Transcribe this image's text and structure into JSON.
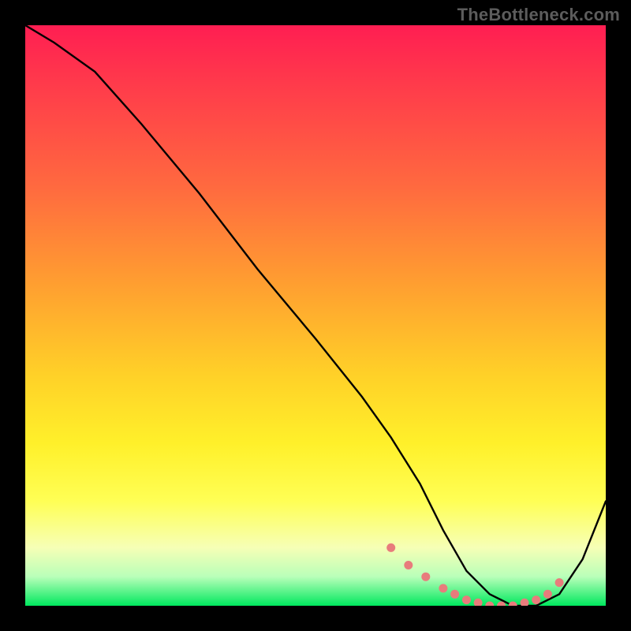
{
  "watermark": "TheBottleneck.com",
  "chart_data": {
    "type": "line",
    "title": "",
    "xlabel": "",
    "ylabel": "",
    "xlim": [
      0,
      100
    ],
    "ylim": [
      0,
      100
    ],
    "series": [
      {
        "name": "curve",
        "x": [
          0,
          5,
          12,
          20,
          30,
          40,
          50,
          58,
          63,
          68,
          72,
          76,
          80,
          84,
          88,
          92,
          96,
          100
        ],
        "y": [
          100,
          97,
          92,
          83,
          71,
          58,
          46,
          36,
          29,
          21,
          13,
          6,
          2,
          0,
          0,
          2,
          8,
          18
        ]
      }
    ],
    "markers": {
      "name": "highlight-dots",
      "color": "#e87c7c",
      "x": [
        63,
        66,
        69,
        72,
        74,
        76,
        78,
        80,
        82,
        84,
        86,
        88,
        90,
        92
      ],
      "y": [
        10,
        7,
        5,
        3,
        2,
        1,
        0.5,
        0,
        0,
        0,
        0.5,
        1,
        2,
        4
      ]
    }
  }
}
